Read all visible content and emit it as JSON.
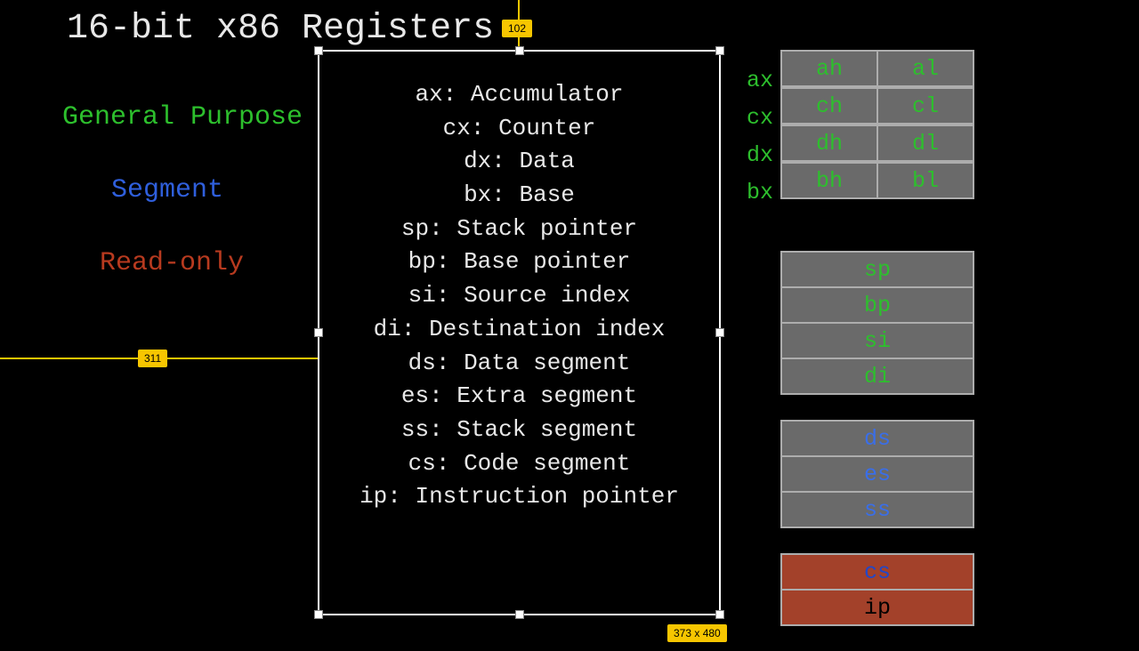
{
  "title": "16-bit x86 Registers",
  "legend": {
    "general_purpose": "General Purpose",
    "segment": "Segment",
    "read_only": "Read-only"
  },
  "guides": {
    "top_offset": "102",
    "left_offset": "311",
    "box_dims": "373 x 480"
  },
  "registers": [
    "ax: Accumulator",
    "cx: Counter",
    "dx: Data",
    "bx: Base",
    "sp: Stack pointer",
    "bp: Base pointer",
    "si: Source index",
    "di: Destination index",
    "ds: Data segment",
    "es: Extra segment",
    "ss: Stack segment",
    "cs: Code segment",
    "ip: Instruction pointer"
  ],
  "gp_table": [
    {
      "name": "ax",
      "hi": "ah",
      "lo": "al"
    },
    {
      "name": "cx",
      "hi": "ch",
      "lo": "cl"
    },
    {
      "name": "dx",
      "hi": "dh",
      "lo": "dl"
    },
    {
      "name": "bx",
      "hi": "bh",
      "lo": "bl"
    }
  ],
  "ptr_table": [
    "sp",
    "bp",
    "si",
    "di"
  ],
  "seg_table": [
    "ds",
    "es",
    "ss"
  ],
  "ro_table": [
    "cs",
    "ip"
  ]
}
